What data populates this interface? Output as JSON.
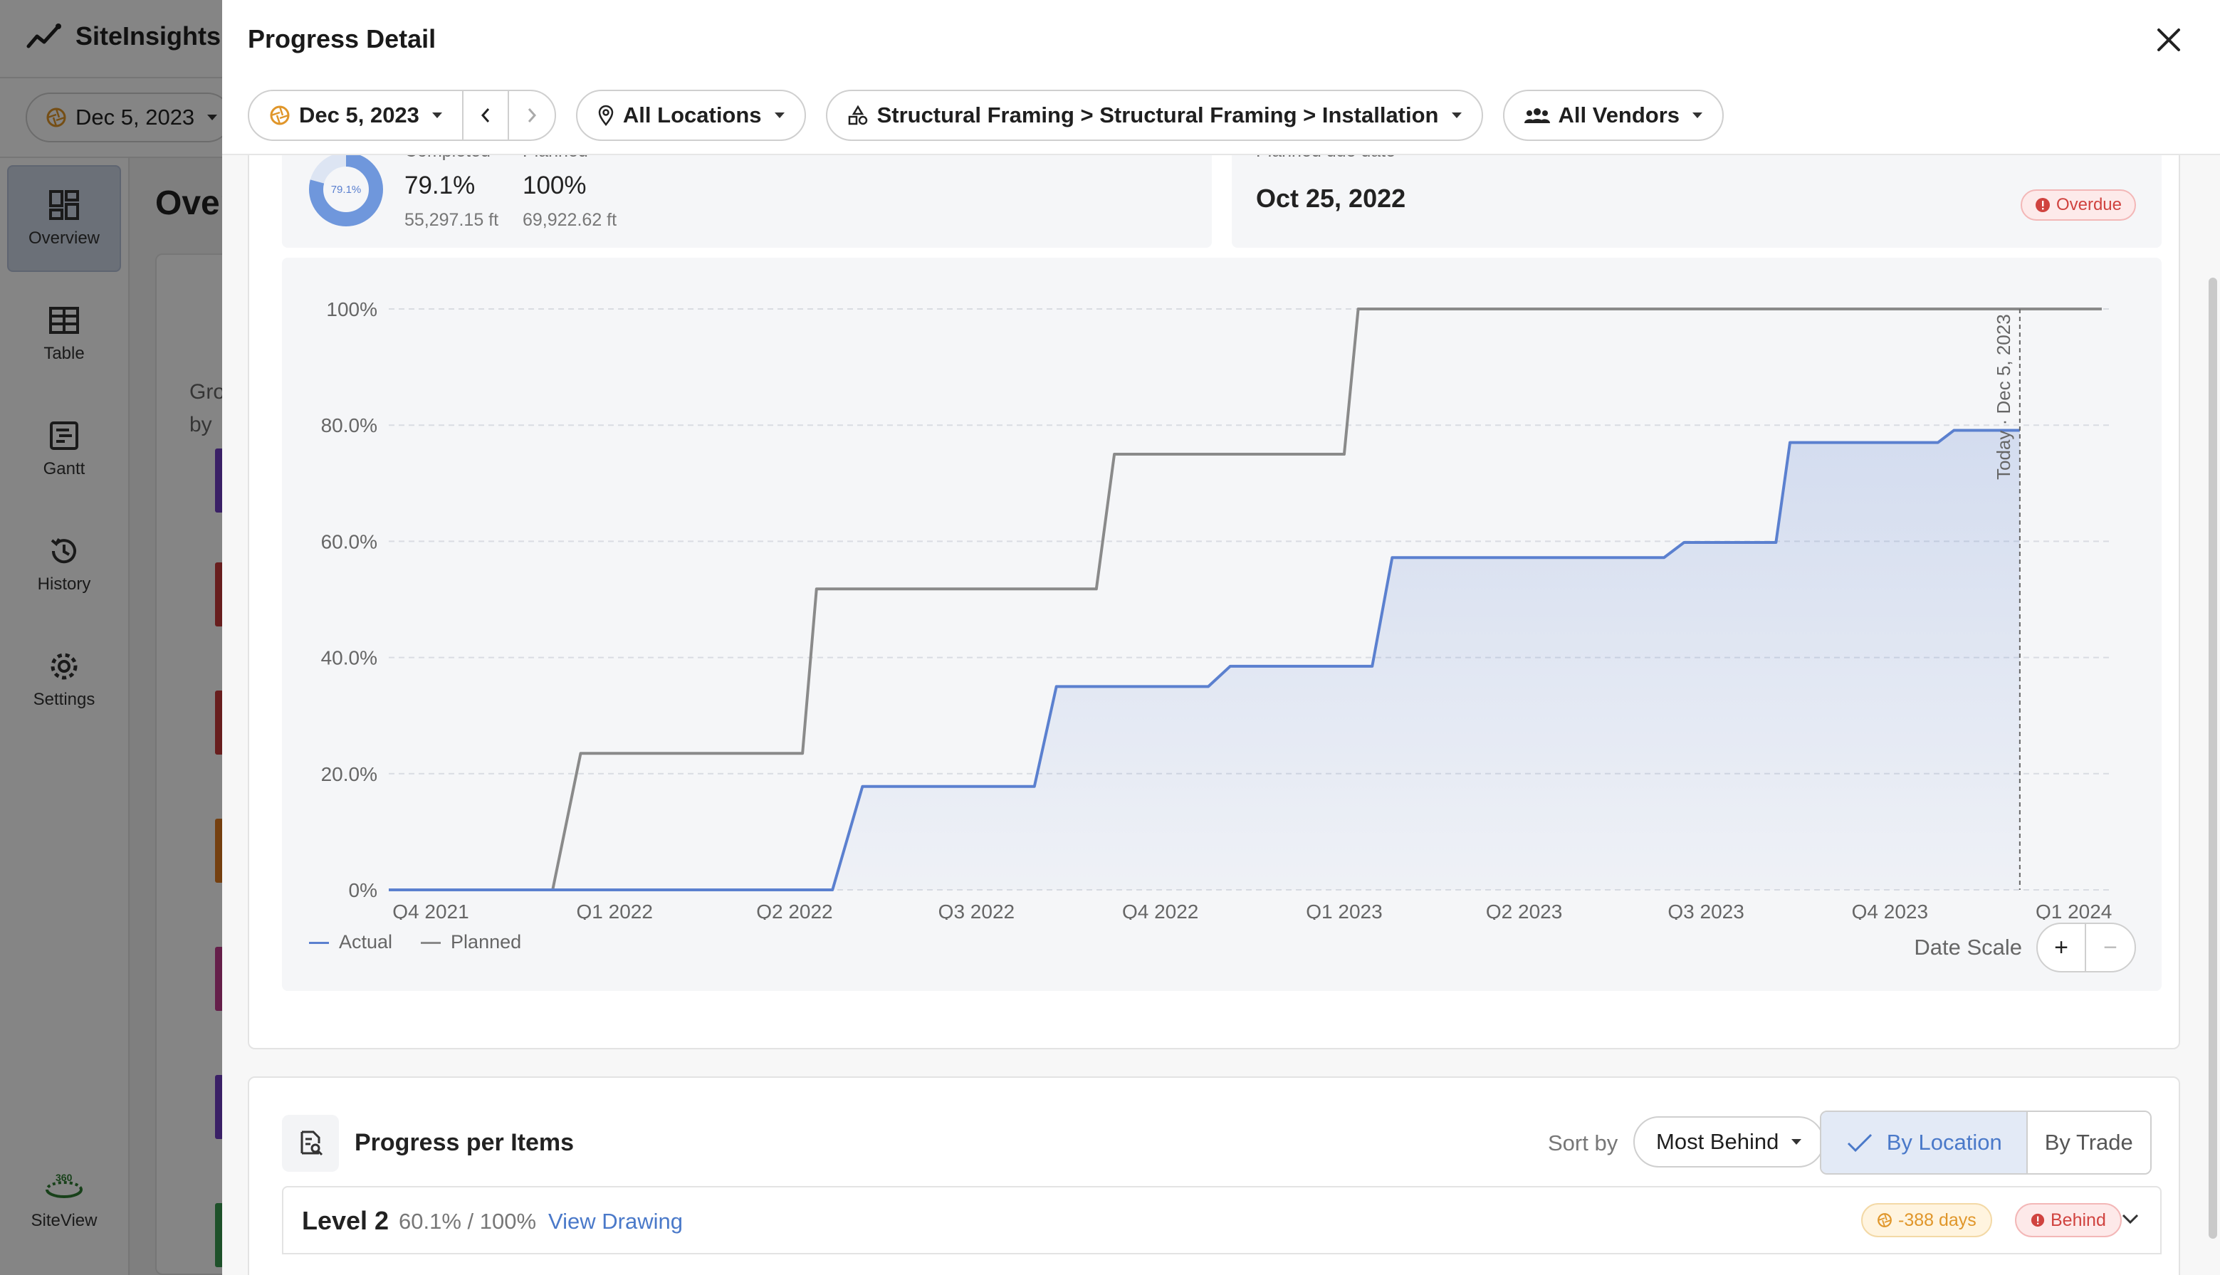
{
  "app": {
    "brand": "SiteInsights",
    "date": "Dec 5, 2023",
    "page_title": "Overview",
    "sidebar": [
      {
        "label": "Overview",
        "icon": "grid-icon"
      },
      {
        "label": "Table",
        "icon": "table-icon"
      },
      {
        "label": "Gantt",
        "icon": "gantt-icon"
      },
      {
        "label": "History",
        "icon": "history-icon"
      },
      {
        "label": "Settings",
        "icon": "gear-icon"
      }
    ],
    "siteview_label": "SiteView",
    "siteview_badge": "360",
    "bg_card_text_1": "Gro",
    "bg_card_text_2": "by"
  },
  "modal": {
    "title": "Progress Detail",
    "filters": {
      "date": "Dec 5, 2023",
      "location": "All Locations",
      "trade": "Structural Framing > Structural Framing > Installation",
      "vendors": "All Vendors"
    }
  },
  "summary": {
    "donut_pct": "79.1%",
    "donut_fraction": 0.791,
    "completed_label": "Completed",
    "completed_pct": "79.1%",
    "completed_qty": "55,297.15 ft",
    "planned_label": "Planned",
    "planned_pct": "100%",
    "planned_qty": "69,922.62 ft",
    "due_label": "Planned due date",
    "due_date": "Oct 25, 2022",
    "status": "Overdue"
  },
  "chart_data": {
    "type": "line",
    "x_tick_labels": [
      "Q4 2021",
      "Q1 2022",
      "Q2 2022",
      "Q3 2022",
      "Q4 2022",
      "Q1 2023",
      "Q2 2023",
      "Q3 2023",
      "Q4 2023",
      "Q1 2024"
    ],
    "y_tick_labels": [
      "0%",
      "20.0%",
      "40.0%",
      "60.0%",
      "80.0%",
      "100%"
    ],
    "ylim": [
      0,
      100
    ],
    "xlim": [
      "2021-09-10",
      "2024-01-20"
    ],
    "grid": true,
    "legend_position": "bottom-left",
    "today_label": "Today · Dec 5, 2023",
    "today_date": "2023-12-05",
    "series": [
      {
        "name": "Actual",
        "color": "#5b80cf",
        "fill": true,
        "points": [
          [
            "2021-09-10",
            0
          ],
          [
            "2022-04-20",
            0
          ],
          [
            "2022-05-05",
            17.8
          ],
          [
            "2022-07-30",
            17.8
          ],
          [
            "2022-08-10",
            35.0
          ],
          [
            "2022-10-25",
            35.0
          ],
          [
            "2022-11-05",
            38.5
          ],
          [
            "2023-01-15",
            38.5
          ],
          [
            "2023-01-25",
            57.2
          ],
          [
            "2023-06-10",
            57.2
          ],
          [
            "2023-06-20",
            59.8
          ],
          [
            "2023-08-05",
            59.8
          ],
          [
            "2023-08-12",
            77.0
          ],
          [
            "2023-10-25",
            77.0
          ],
          [
            "2023-11-02",
            79.1
          ],
          [
            "2023-12-05",
            79.1
          ]
        ]
      },
      {
        "name": "Planned",
        "color": "#8a8a8a",
        "fill": false,
        "points": [
          [
            "2021-09-10",
            0
          ],
          [
            "2021-12-01",
            0
          ],
          [
            "2021-12-15",
            23.5
          ],
          [
            "2022-04-05",
            23.5
          ],
          [
            "2022-04-12",
            51.8
          ],
          [
            "2022-08-30",
            51.8
          ],
          [
            "2022-09-08",
            75.0
          ],
          [
            "2023-01-01",
            75.0
          ],
          [
            "2023-01-08",
            100
          ],
          [
            "2024-01-15",
            100
          ]
        ]
      }
    ]
  },
  "date_scale": {
    "label": "Date Scale",
    "zoom_in": "+",
    "zoom_out": "−"
  },
  "items": {
    "title": "Progress per Items",
    "sort_label": "Sort by",
    "sort_value": "Most Behind",
    "by_location": "By Location",
    "by_trade": "By Trade",
    "rows": [
      {
        "name": "Level 2",
        "pct": "60.1% / 100%",
        "link": "View Drawing",
        "days": "-388 days",
        "status": "Behind"
      }
    ]
  },
  "colors": {
    "accent": "#4a79c9",
    "overdue": "#d0433f",
    "days": "#e0962a"
  }
}
